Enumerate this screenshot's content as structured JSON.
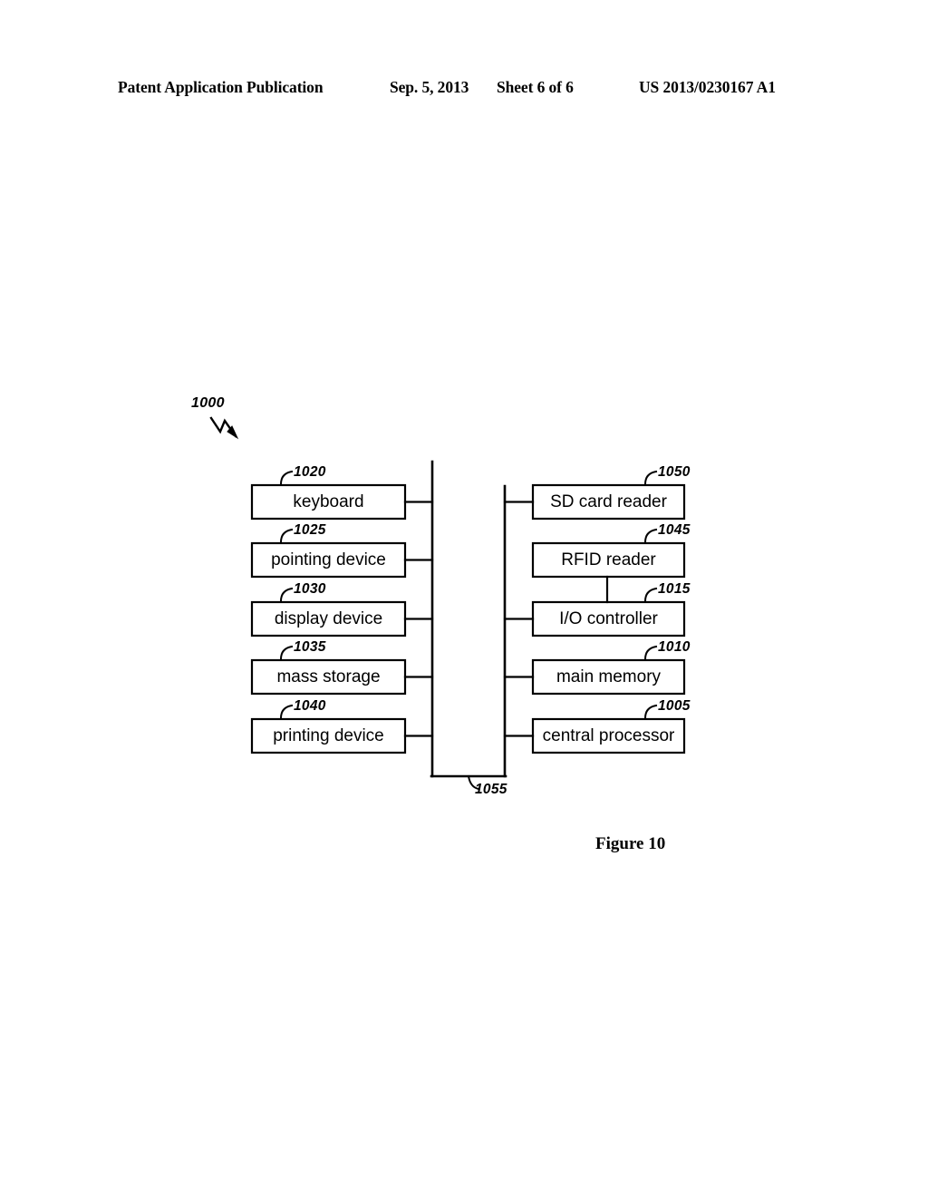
{
  "header": {
    "publication": "Patent Application Publication",
    "date": "Sep. 5, 2013",
    "sheet": "Sheet 6 of 6",
    "patent_number": "US 2013/0230167 A1"
  },
  "figure": {
    "caption": "Figure 10",
    "system_ref": "1000",
    "bus_ref": "1055",
    "left_column": [
      {
        "label": "keyboard",
        "ref": "1020"
      },
      {
        "label": "pointing device",
        "ref": "1025"
      },
      {
        "label": "display device",
        "ref": "1030"
      },
      {
        "label": "mass storage",
        "ref": "1035"
      },
      {
        "label": "printing device",
        "ref": "1040"
      }
    ],
    "right_column": [
      {
        "label": "SD card reader",
        "ref": "1050"
      },
      {
        "label": "RFID reader",
        "ref": "1045"
      },
      {
        "label": "I/O controller",
        "ref": "1015"
      },
      {
        "label": "main memory",
        "ref": "1010"
      },
      {
        "label": "central processor",
        "ref": "1005"
      }
    ]
  },
  "colors": {
    "ink": "#000000",
    "paper": "#ffffff"
  }
}
